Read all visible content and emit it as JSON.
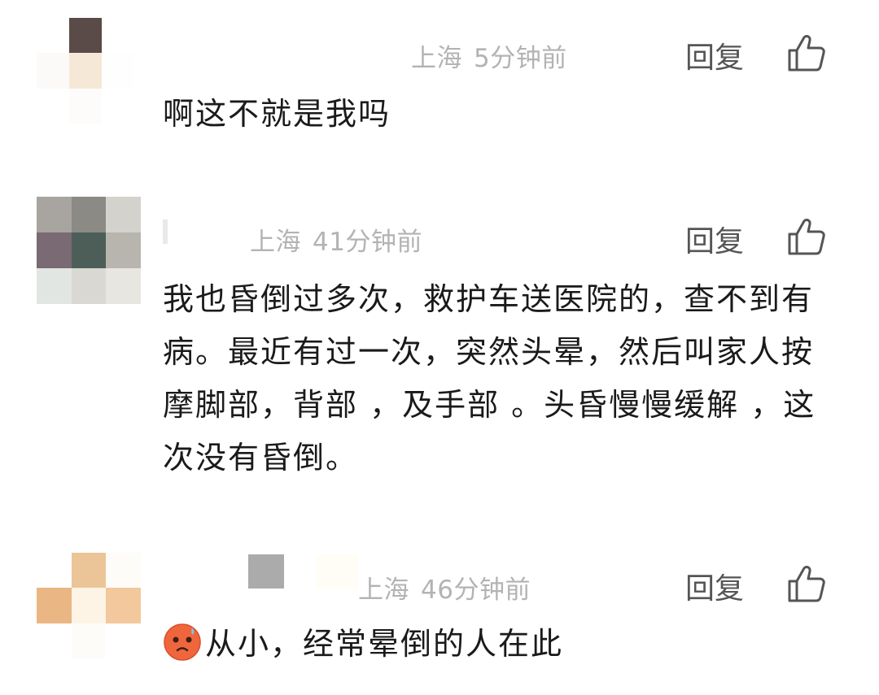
{
  "comments": [
    {
      "location": "上海",
      "time": "5分钟前",
      "reply_label": "回复",
      "text": "啊这不就是我吗"
    },
    {
      "location": "上海",
      "time": "41分钟前",
      "reply_label": "回复",
      "text": "我也昏倒过多次，救护车送医院的，查不到有病。最近有过一次，突然头晕，然后叫家人按摩脚部，背部 ，及手部 。头昏慢慢缓解 ，这次没有昏倒。"
    },
    {
      "location": "上海",
      "time": "46分钟前",
      "reply_label": "回复",
      "emoji": "dizzy-face-emoji",
      "text": "从小，经常晕倒的人在此"
    }
  ],
  "colors": {
    "meta_text": "#b3b3b3",
    "body_text": "#1a1a1a",
    "reply_text": "#555555"
  },
  "icons": {
    "like": "thumbs-up-icon"
  }
}
